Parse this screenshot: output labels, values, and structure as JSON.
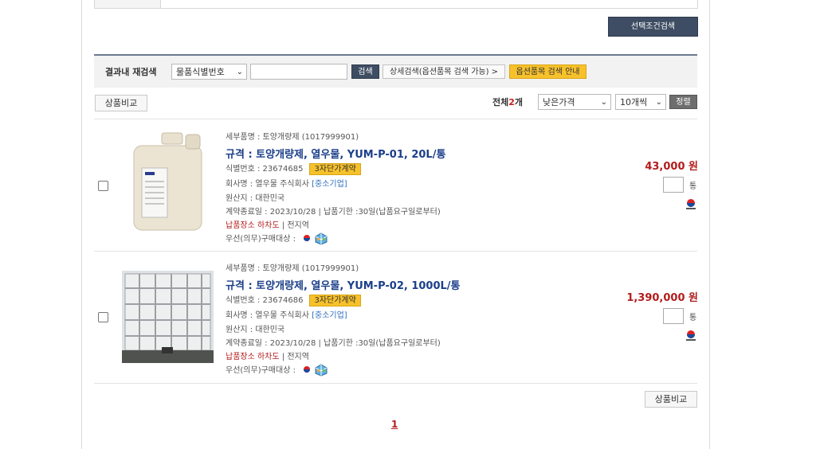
{
  "top_filter": {
    "search_button": "선택조건검색"
  },
  "research": {
    "label": "결과내 재검색",
    "field_select": "물품식별번호",
    "query_value": "",
    "search_button": "검색",
    "detail_search_button": "상세검색(옵션품목 검색 가능) >",
    "option_guide_button": "옵션품목 검색 안내"
  },
  "toolbar": {
    "compare_button": "상품비교",
    "total_prefix": "전체",
    "total_count": "2",
    "total_suffix": "개",
    "sort_select": "낮은가격",
    "per_page_select": "10개씩",
    "sort_button": "정렬"
  },
  "products": [
    {
      "detail_item": "세부품명 : 토양개량제 (1017999901)",
      "spec": "규격 : 토양개량제, 열우물, YUM-P-01, 20L/통",
      "id_label": "식별번호 : 23674685",
      "contract_tag": "3자단가계약",
      "company_label": "회사명 : 열우물 주식회사",
      "company_type": "[중소기업]",
      "origin": "원산지 : 대한민국",
      "contract_end": "계약종료일 : 2023/10/28 | 납품기한 :30일(납품요구일로부터)",
      "delivery_place": "납품장소 하차도",
      "delivery_area": " | 전지역",
      "priority": "우선(의무)구매대상 :",
      "price": "43,000 원",
      "unit": "통",
      "image": "white-jerrycan-20l"
    },
    {
      "detail_item": "세부품명 : 토양개량제 (1017999901)",
      "spec": "규격 : 토양개량제, 열우물, YUM-P-02, 1000L/통",
      "id_label": "식별번호 : 23674686",
      "contract_tag": "3자단가계약",
      "company_label": "회사명 : 열우물 주식회사",
      "company_type": "[중소기업]",
      "origin": "원산지 : 대한민국",
      "contract_end": "계약종료일 : 2023/10/28 | 납품기한 :30일(납품요구일로부터)",
      "delivery_place": "납품장소 하차도",
      "delivery_area": " | 전지역",
      "priority": "우선(의무)구매대상 :",
      "price": "1,390,000 원",
      "unit": "통",
      "image": "ibc-tote-1000l"
    }
  ],
  "bottom": {
    "compare_button": "상품비교",
    "page": "1"
  }
}
